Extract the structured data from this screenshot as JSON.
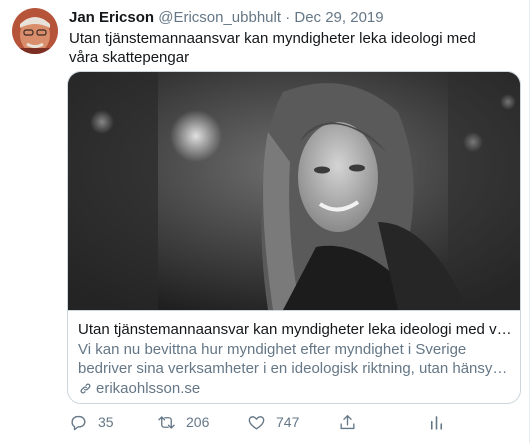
{
  "tweet": {
    "author_name": "Jan Ericson",
    "handle": "@Ericson_ubbhult",
    "separator": "·",
    "date": "Dec 29, 2019",
    "text": "Utan tjänstemannaansvar kan myndigheter leka ideologi med våra skattepengar"
  },
  "card": {
    "title": "Utan tjänstemannaansvar kan myndigheter leka ideologi med våra skatt…",
    "description": "Vi kan nu bevittna hur myndighet efter myndighet i Sverige bedriver sina verksamheter i en ideologisk riktning, utan hänsyn till verksamhetens …",
    "domain": "erikaohlsson.se",
    "link_icon": "link-icon"
  },
  "actions": {
    "reply": {
      "icon": "reply-icon",
      "count": "35"
    },
    "retweet": {
      "icon": "retweet-icon",
      "count": "206"
    },
    "like": {
      "icon": "heart-icon",
      "count": "747"
    },
    "share": {
      "icon": "share-icon"
    },
    "analytics": {
      "icon": "analytics-icon"
    }
  },
  "colors": {
    "primary_text": "#14171a",
    "secondary_text": "#657786",
    "border": "#ccd6dd"
  }
}
